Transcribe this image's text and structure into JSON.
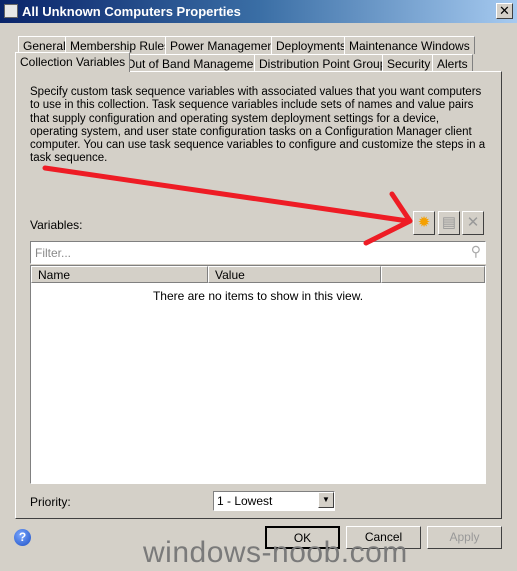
{
  "window": {
    "title": "All Unknown Computers Properties",
    "close": "✕"
  },
  "tabs": {
    "row1": [
      "General",
      "Membership Rules",
      "Power Management",
      "Deployments",
      "Maintenance Windows"
    ],
    "row2": [
      "Collection Variables",
      "Out of Band Management",
      "Distribution Point Groups",
      "Security",
      "Alerts"
    ],
    "selected": "Collection Variables"
  },
  "description": "Specify custom task sequence variables with associated values that you want computers to use in this collection. Task sequence variables include sets of names and value pairs that supply configuration and operating system deployment settings for a device, operating system, and user state configuration tasks on a Configuration Manager client computer. You can use task sequence variables to configure and customize the steps in a task sequence.",
  "variables": {
    "label": "Variables:",
    "toolbar": [
      {
        "icon": "new-star-icon",
        "enabled": true
      },
      {
        "icon": "properties-icon",
        "enabled": false
      },
      {
        "icon": "delete-x-icon",
        "enabled": false
      }
    ],
    "filter_placeholder": "Filter...",
    "columns": [
      "Name",
      "Value"
    ],
    "empty_text": "There are no items to show in this view."
  },
  "priority": {
    "label": "Priority:",
    "value": "1 - Lowest"
  },
  "buttons": {
    "ok": "OK",
    "cancel": "Cancel",
    "apply": "Apply"
  },
  "annotation_color": "#ee1c25",
  "watermark": "windows-noob.com"
}
